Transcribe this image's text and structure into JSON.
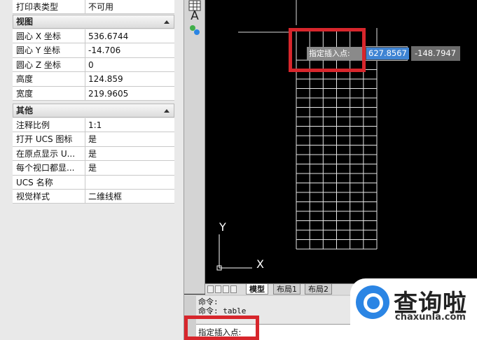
{
  "properties": {
    "top_row": {
      "key": "打印表类型",
      "value": "不可用"
    },
    "sections": [
      {
        "title": "视图",
        "rows": [
          {
            "key": "圆心 X 坐标",
            "value": "536.6744"
          },
          {
            "key": "圆心 Y 坐标",
            "value": "-14.706"
          },
          {
            "key": "圆心 Z 坐标",
            "value": "0"
          },
          {
            "key": "高度",
            "value": "124.859"
          },
          {
            "key": "宽度",
            "value": "219.9605"
          }
        ]
      },
      {
        "title": "其他",
        "rows": [
          {
            "key": "注释比例",
            "value": "1:1"
          },
          {
            "key": "打开 UCS 图标",
            "value": "是"
          },
          {
            "key": "在原点显示 U...",
            "value": "是"
          },
          {
            "key": "每个视口都显...",
            "value": "是"
          },
          {
            "key": "UCS 名称",
            "value": ""
          },
          {
            "key": "视觉样式",
            "value": "二维线框"
          }
        ]
      }
    ]
  },
  "toolbar": {
    "icons": [
      "table-icon",
      "text-icon",
      "attribute-icon"
    ],
    "text_glyph": "A"
  },
  "canvas": {
    "tooltip_label": "指定插入点:",
    "coord_x": "627.8567",
    "coord_y": "-148.7947",
    "ucs_labels": {
      "y": "Y",
      "x": "X"
    },
    "table_grid": {
      "rows": 20,
      "cols": 6
    }
  },
  "tabs": [
    "模型",
    "布局1",
    "布局2"
  ],
  "command": {
    "history": [
      "命令:",
      "命令:  table"
    ],
    "prompt": "指定插入点:"
  },
  "watermark": {
    "brand": "查询啦",
    "url": "chaxunla.com"
  },
  "colors": {
    "highlight": "#d7262c",
    "selection": "#3f84d3",
    "watermark": "#2b85e4"
  }
}
